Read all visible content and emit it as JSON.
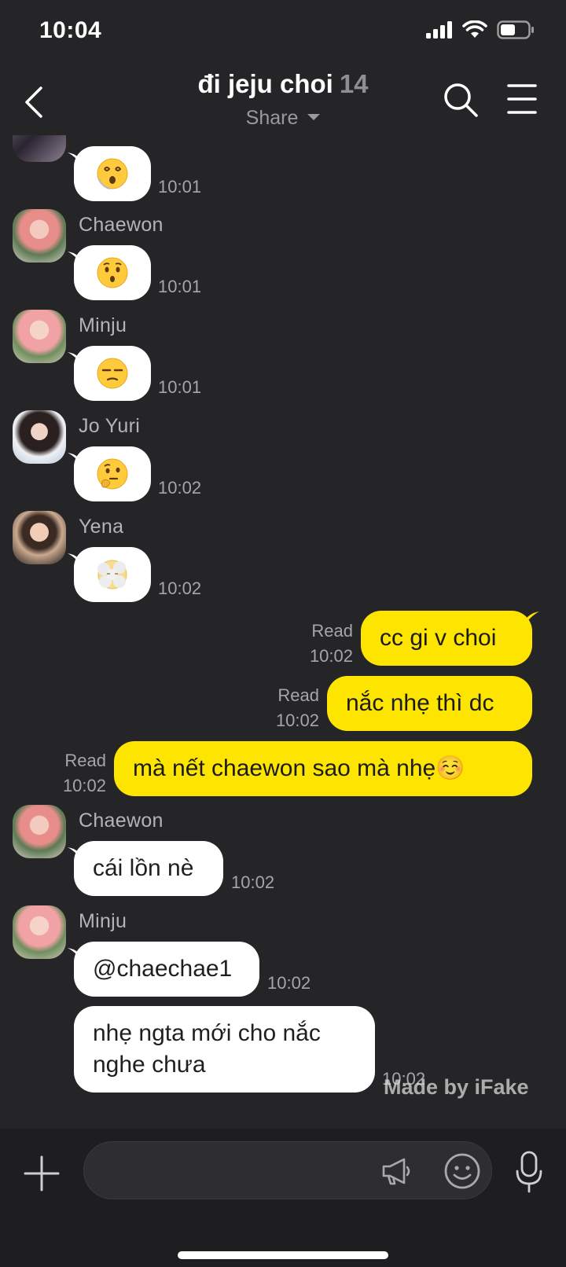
{
  "status_bar": {
    "time": "10:04"
  },
  "header": {
    "title": "đi jeju choi",
    "member_count": "14",
    "share_label": "Share"
  },
  "messages": [
    {
      "time": "10:01",
      "emoji": "dizzy-face"
    },
    {
      "sender": "Chaewon",
      "time": "10:01",
      "emoji": "hushed-face"
    },
    {
      "sender": "Minju",
      "time": "10:01",
      "emoji": "unamused-face"
    },
    {
      "sender": "Jo Yuri",
      "time": "10:02",
      "emoji": "thinking-face"
    },
    {
      "sender": "Yena",
      "time": "10:02",
      "emoji": "face-in-clouds"
    },
    {
      "text": "cc gi v choi",
      "read": "Read",
      "time": "10:02"
    },
    {
      "text": "nắc nhẹ thì dc",
      "read": "Read",
      "time": "10:02"
    },
    {
      "text": "mà nết chaewon sao mà nhẹ☺️",
      "read": "Read",
      "time": "10:02"
    },
    {
      "sender": "Chaewon",
      "text": "cái lồn nè",
      "time": "10:02"
    },
    {
      "sender": "Minju",
      "text": "@chaechae1",
      "time": "10:02"
    },
    {
      "text": "nhẹ ngta mới cho nắc nghe chưa",
      "time": "10:02"
    }
  ],
  "watermark": "Made by iFake",
  "input": {
    "placeholder": ""
  },
  "colors": {
    "background": "#252527",
    "outgoing_bubble": "#fee500",
    "incoming_bubble": "#ffffff",
    "input_bar": "#1e1e20"
  }
}
